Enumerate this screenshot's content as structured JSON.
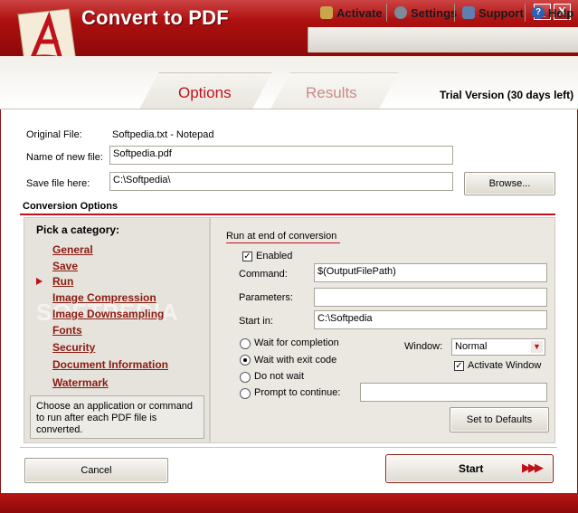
{
  "window": {
    "title": "Convert to PDF",
    "minimize_label": "_",
    "close_label": "X"
  },
  "toolbar": {
    "activate": "Activate",
    "settings": "Settings",
    "support": "Support",
    "help": "Help"
  },
  "tabs": {
    "options": "Options",
    "results": "Results",
    "active": "Options"
  },
  "trial_text": "Trial Version (30 days left)",
  "file": {
    "original_label": "Original File:",
    "original_value": "Softpedia.txt - Notepad",
    "newname_label": "Name of new  file:",
    "newname_value": "Softpedia.pdf",
    "save_label": "Save file here:",
    "save_value": "C:\\Softpedia\\",
    "browse_label": "Browse..."
  },
  "conversion": {
    "title": "Conversion Options",
    "pick_title": "Pick a category:",
    "categories": [
      "General",
      "Save",
      "Run",
      "Image Compression",
      "Image Downsampling",
      "Fonts",
      "Security",
      "Document Information",
      "Watermark"
    ],
    "selected": "Run",
    "hint": "Choose an application or command to run after each PDF file is converted.",
    "watermark_text": "SOFTPEDIA"
  },
  "run": {
    "section_title": "Run at end of conversion",
    "enabled_label": "Enabled",
    "enabled_checked": true,
    "command_label": "Command:",
    "command_value": "$(OutputFilePath)",
    "parameters_label": "Parameters:",
    "parameters_value": "",
    "startin_label": "Start in:",
    "startin_value": "C:\\Softpedia",
    "wait_options": [
      "Wait for completion",
      "Wait with exit code",
      "Do not wait",
      "Prompt to continue:"
    ],
    "wait_selected": "Wait with exit code",
    "prompt_value": "",
    "window_label": "Window:",
    "window_value": "Normal",
    "activate_window_label": "Activate Window",
    "activate_window_checked": true,
    "defaults_label": "Set to Defaults"
  },
  "footer": {
    "cancel_label": "Cancel",
    "start_label": "Start",
    "start_arrows": "▶▶▶"
  },
  "colors": {
    "brand_red": "#c0111b",
    "title_bar": "#a90f0f",
    "panel_bg": "#e6e3dc"
  }
}
